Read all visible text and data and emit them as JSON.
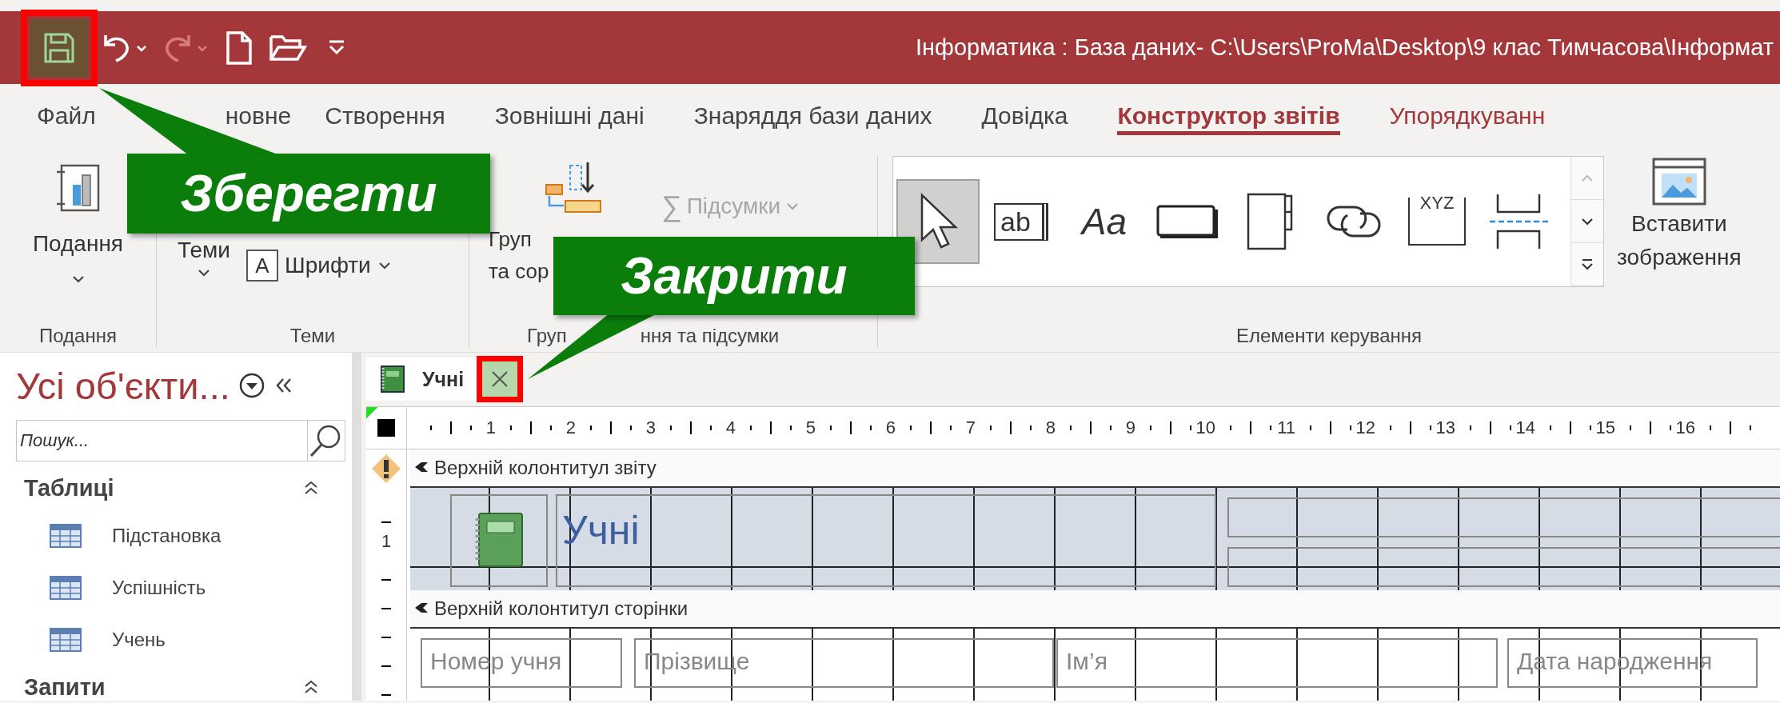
{
  "window": {
    "title": "Інформатика : База даних- C:\\Users\\ProMa\\Desktop\\9 клас Тимчасова\\Інформат"
  },
  "quick_access": [
    {
      "kind": "save",
      "highlighted": true,
      "disabled": false
    },
    {
      "kind": "undo",
      "highlighted": false,
      "disabled": false
    },
    {
      "kind": "redo",
      "highlighted": false,
      "disabled": true
    },
    {
      "kind": "new",
      "highlighted": false,
      "disabled": false
    },
    {
      "kind": "open",
      "highlighted": false,
      "disabled": false
    },
    {
      "kind": "customize",
      "highlighted": false,
      "disabled": false
    }
  ],
  "ribbon_tabs": [
    {
      "label": "Файл",
      "selected": false,
      "contextual": false
    },
    {
      "label": "новне",
      "selected": false,
      "contextual": false
    },
    {
      "label": "Створення",
      "selected": false,
      "contextual": false
    },
    {
      "label": "Зовнішні дані",
      "selected": false,
      "contextual": false
    },
    {
      "label": "Знаряддя бази даних",
      "selected": false,
      "contextual": false
    },
    {
      "label": "Довідка",
      "selected": false,
      "contextual": false
    },
    {
      "label": "Конструктор звітів",
      "selected": true,
      "contextual": true
    },
    {
      "label": "Упорядкуванн",
      "selected": false,
      "contextual": true
    }
  ],
  "ribbon": {
    "views": {
      "button": "Подання",
      "label": "Подання"
    },
    "themes": {
      "themes_button": "Теми",
      "fonts": {
        "glyph": "A",
        "label": "Шрифти"
      },
      "label": "Теми"
    },
    "grouping": {
      "button_lines": [
        "Груп",
        "та сор"
      ],
      "totals": {
        "icon": "∑",
        "label": "Підсумки",
        "disabled": true
      },
      "label_parts": [
        "Груп",
        "ння та підсумки"
      ]
    },
    "controls": {
      "gallery": [
        {
          "kind": "select",
          "selected": true
        },
        {
          "kind": "textbox",
          "glyph": "ab",
          "selected": false
        },
        {
          "kind": "label",
          "glyph": "Aa",
          "selected": false
        },
        {
          "kind": "button",
          "selected": false
        },
        {
          "kind": "tabs",
          "selected": false
        },
        {
          "kind": "link",
          "selected": false
        },
        {
          "kind": "group",
          "glyph": "XYZ",
          "selected": false
        },
        {
          "kind": "pagebreak",
          "selected": false
        }
      ],
      "insert_image": [
        "Вставити",
        "зображення"
      ],
      "label": "Елементи керування"
    }
  },
  "nav": {
    "title": "Усі об'єкти...",
    "search": {
      "placeholder": "Пошук..."
    },
    "sections": [
      {
        "title": "Таблиці",
        "expanded": true,
        "items": [
          {
            "label": "Підстановка"
          },
          {
            "label": "Успішність"
          },
          {
            "label": "Учень"
          }
        ]
      },
      {
        "title": "Запити",
        "expanded": true
      }
    ]
  },
  "document": {
    "tab": {
      "label": "Учні",
      "selected": true,
      "close_highlighted": true
    },
    "ruler": [
      "1",
      "2",
      "3",
      "4",
      "5",
      "6",
      "7",
      "8",
      "9",
      "10",
      "11",
      "12",
      "13",
      "14",
      "15",
      "16"
    ],
    "vertical_ruler": [
      "1"
    ],
    "report_header": {
      "title": "Верхній колонтитул звіту",
      "heading": "Учні"
    },
    "page_header": {
      "title": "Верхній колонтитул сторінки",
      "labels": [
        "Номер учня",
        "Прізвище",
        "Ім’я",
        "Дата народження"
      ]
    }
  },
  "callouts": [
    {
      "text": "Зберегти"
    },
    {
      "text": "Закрити"
    }
  ]
}
